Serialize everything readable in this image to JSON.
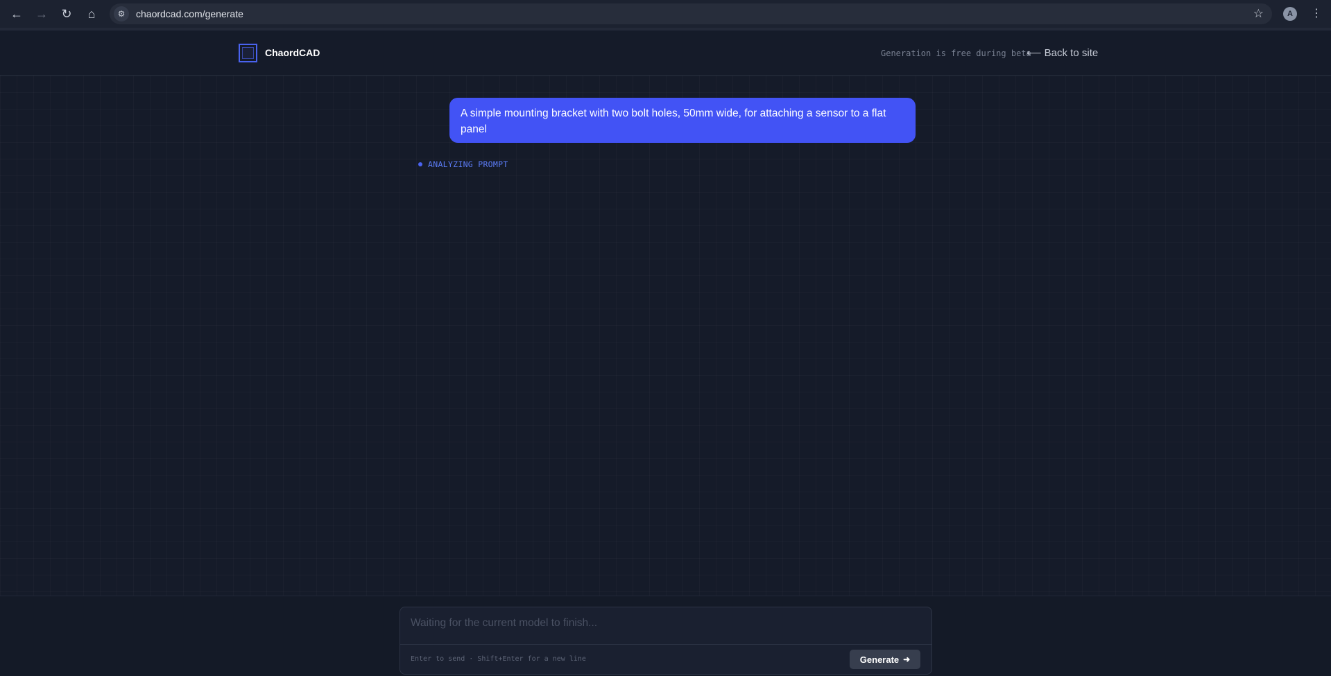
{
  "browser": {
    "url": "chaordcad.com/generate",
    "profile_initial": "A"
  },
  "header": {
    "brand": "ChaordCAD",
    "beta_note": "Generation is free during beta",
    "back_link": "⟵ Back to site"
  },
  "conversation": {
    "user_message": "A simple mounting bracket with two bolt holes, 50mm wide, for attaching a sensor to a flat panel",
    "status": "ANALYZING PROMPT"
  },
  "composer": {
    "placeholder": "Waiting for the current model to finish...",
    "hint": "Enter to send · Shift+Enter for a new line",
    "button_label": "Generate"
  },
  "colors": {
    "accent": "#4253f5",
    "background": "#141a28"
  }
}
